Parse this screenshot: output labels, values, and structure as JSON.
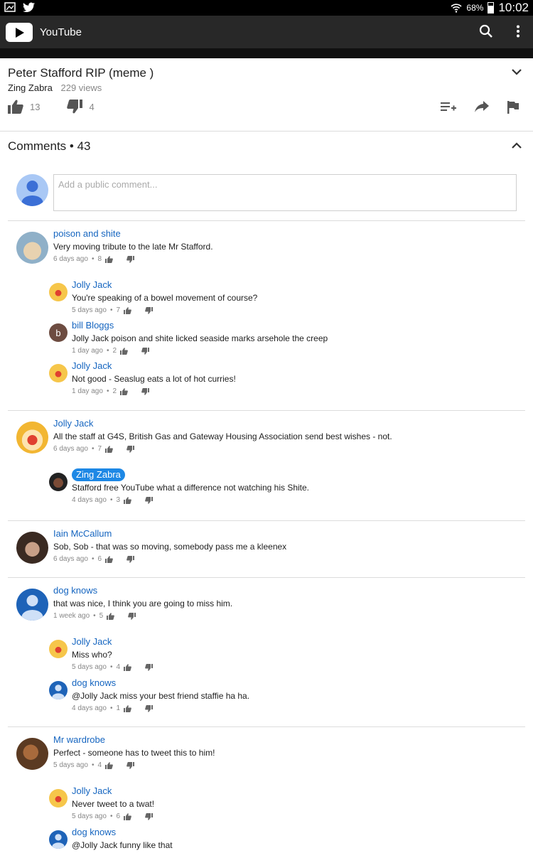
{
  "statusbar": {
    "battery": "68%",
    "time": "10:02"
  },
  "appbar": {
    "title": "YouTube"
  },
  "video": {
    "title": "Peter Stafford RIP (meme )",
    "channel": "Zing Zabra",
    "views": "229 views",
    "likes": "13",
    "dislikes": "4"
  },
  "comments_section": {
    "header": "Comments",
    "count": "43",
    "placeholder": "Add a public comment..."
  },
  "comments": [
    {
      "author": "poison and shite",
      "text": "Very moving tribute to the late Mr Stafford.",
      "time": "6 days ago",
      "likes": "8",
      "replies": [
        {
          "author": "Jolly Jack",
          "text": "You're speaking of a bowel movement of course?",
          "time": "5 days ago",
          "likes": "7"
        },
        {
          "author": "bill Bloggs",
          "avatar_letter": "b",
          "text": "Jolly Jack poison and shite licked seaside marks arsehole the creep",
          "time": "1 day ago",
          "likes": "2"
        },
        {
          "author": "Jolly Jack",
          "text": "Not good - Seaslug eats a lot of hot curries!",
          "time": "1 day ago",
          "likes": "2"
        }
      ]
    },
    {
      "author": "Jolly Jack",
      "text": "All the staff at G4S, British Gas and Gateway Housing Association send best wishes - not.",
      "time": "6 days ago",
      "likes": "7",
      "replies": [
        {
          "author": "Zing Zabra",
          "text": "Stafford free YouTube  what a difference not watching his Shite.",
          "time": "4 days ago",
          "likes": "3"
        }
      ]
    },
    {
      "author": "Iain McCallum",
      "text": "Sob, Sob - that was so moving, somebody pass me a kleenex",
      "time": "6 days ago",
      "likes": "6",
      "replies": []
    },
    {
      "author": "dog knows",
      "text": "that was nice, I think you are going to miss him.",
      "time": "1 week ago",
      "likes": "5",
      "replies": [
        {
          "author": "Jolly Jack",
          "text": "Miss who?",
          "time": "5 days ago",
          "likes": "4"
        },
        {
          "author": "dog knows",
          "text": "@Jolly Jack miss your best friend staffie ha ha.",
          "time": "4 days ago",
          "likes": "1"
        }
      ]
    },
    {
      "author": "Mr wardrobe",
      "text": "Perfect - someone has to tweet this to him!",
      "time": "5 days ago",
      "likes": "4",
      "replies": [
        {
          "author": "Jolly Jack",
          "text": "Never tweet to a twat!",
          "time": "5 days ago",
          "likes": "6"
        },
        {
          "author": "dog knows",
          "text": "@Jolly Jack funny like that"
        }
      ]
    }
  ]
}
